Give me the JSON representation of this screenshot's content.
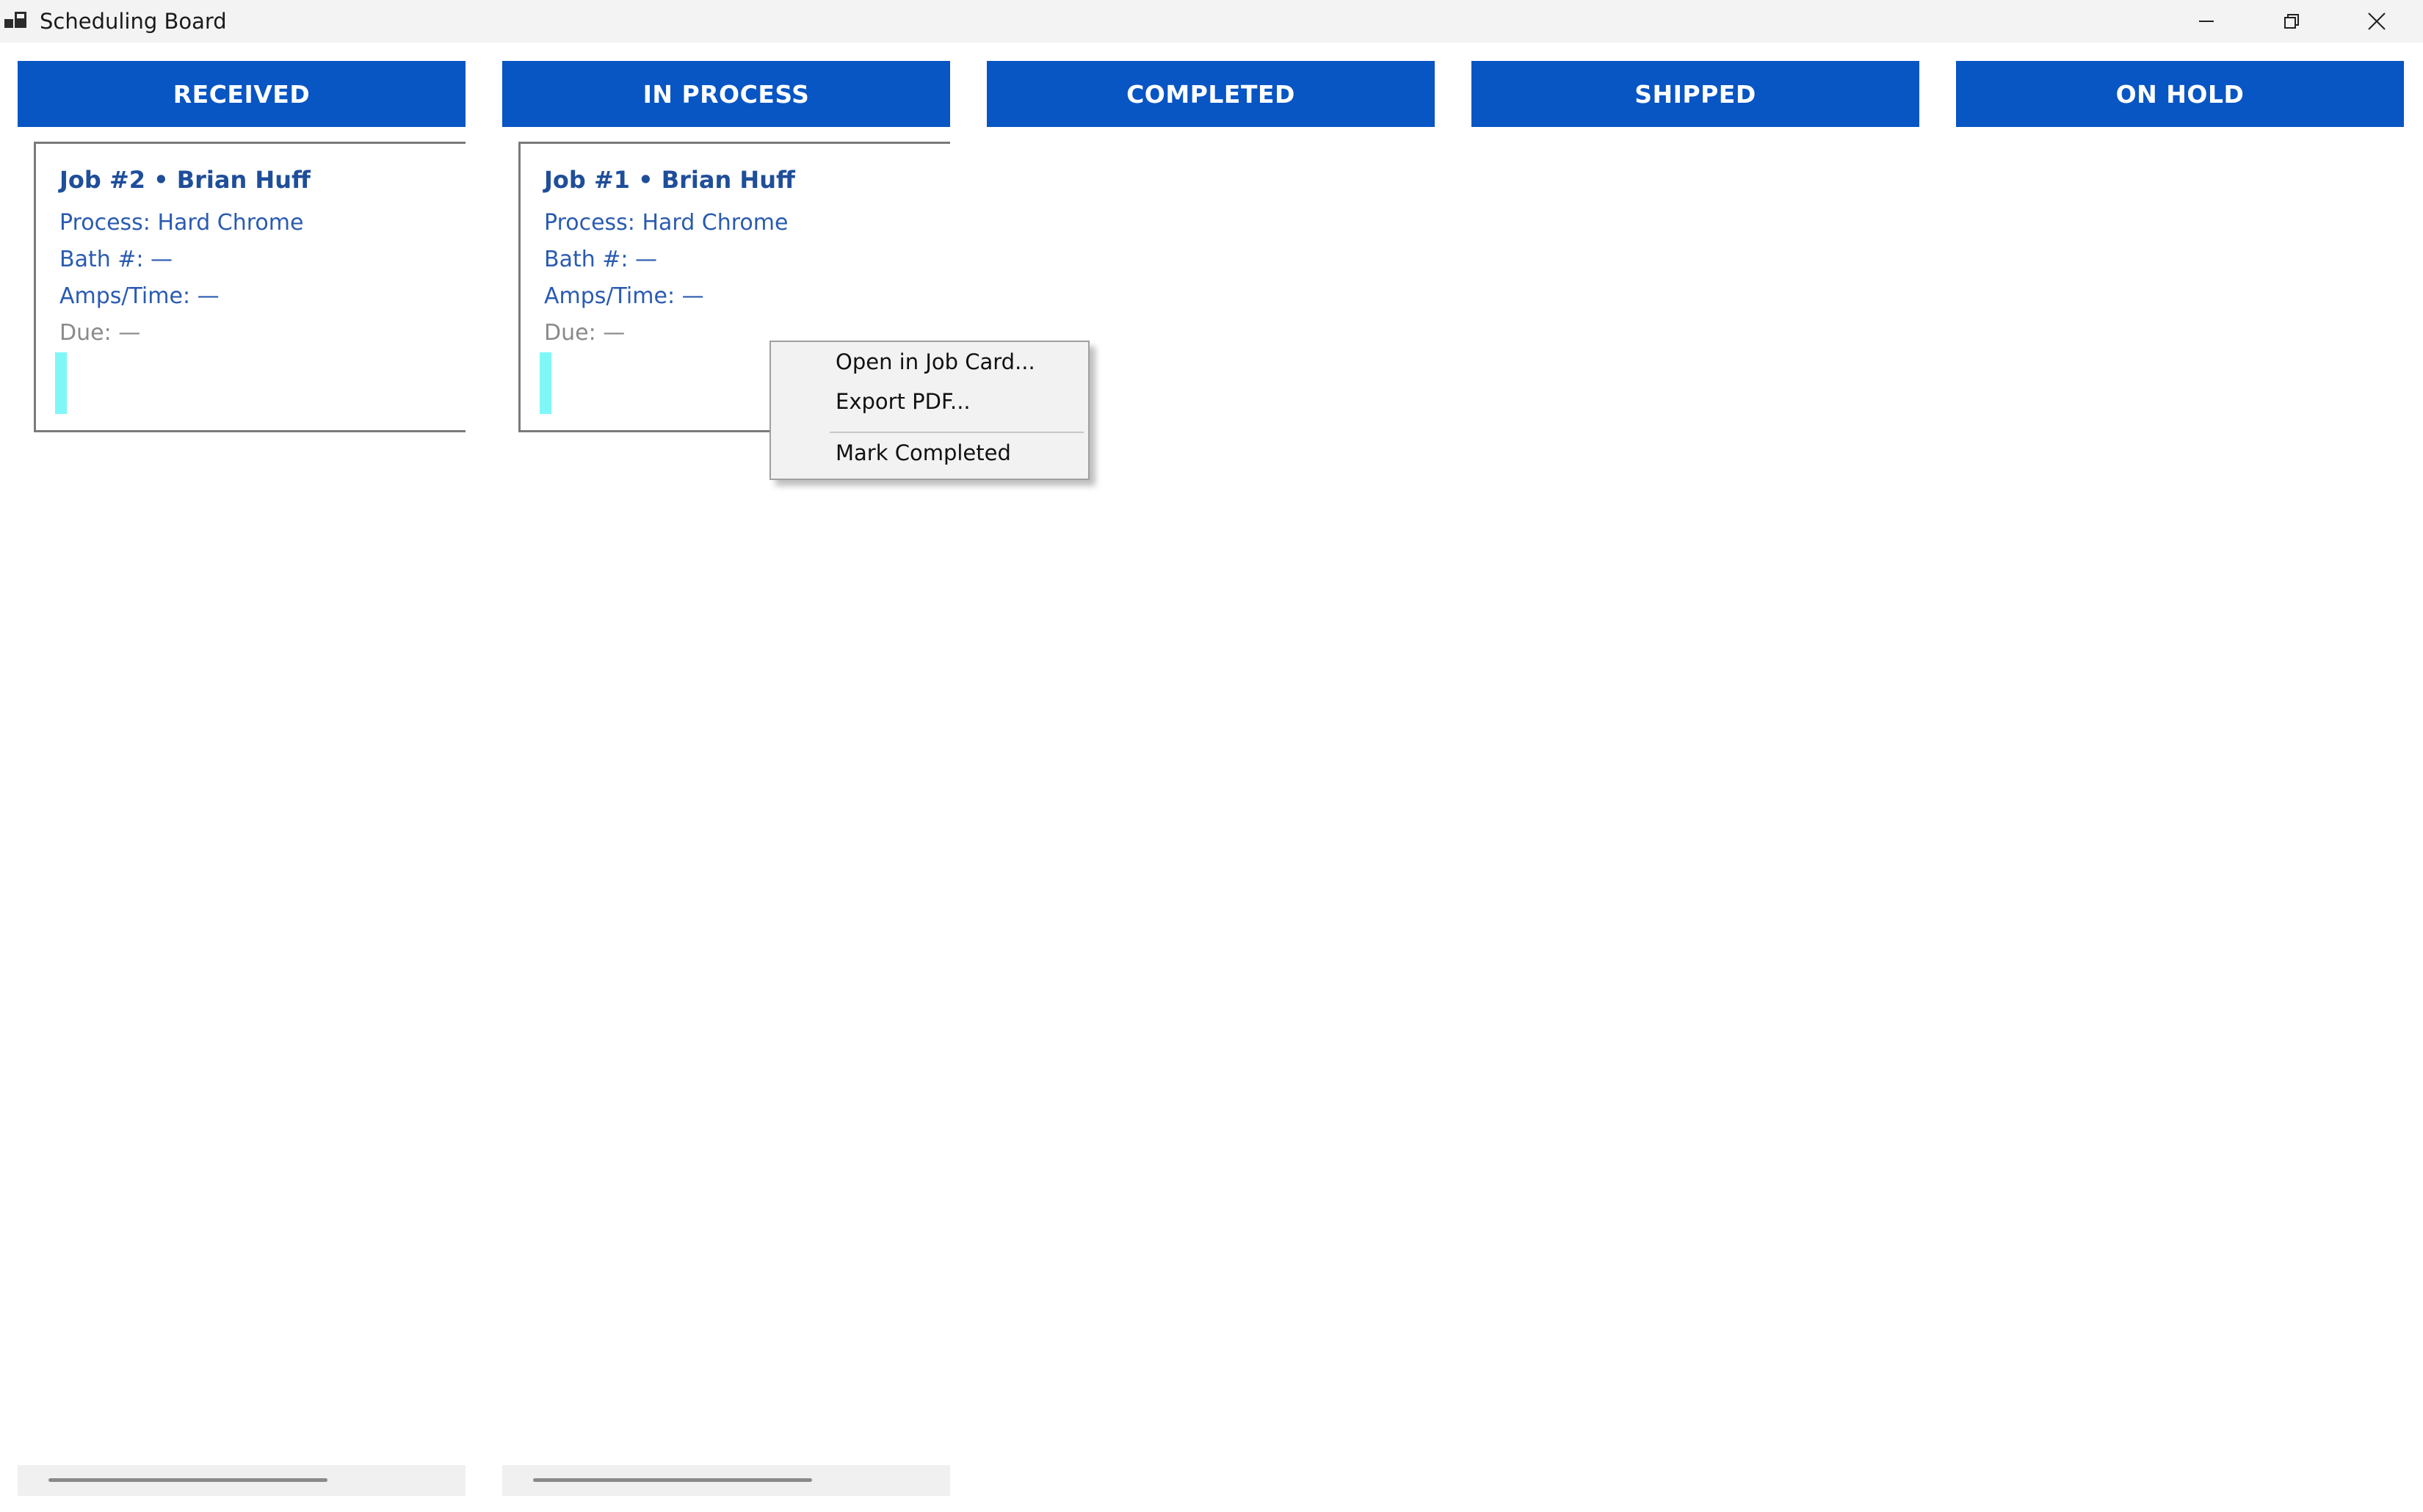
{
  "window": {
    "title": "Scheduling Board",
    "app_icon": "app-window-icon",
    "controls": [
      "minimize-icon",
      "restore-icon",
      "close-icon"
    ]
  },
  "colors": {
    "header_bg": "#0855c4",
    "card_title": "#1f4e9a",
    "card_text": "#2a5bb0",
    "accent": "#7ff7f7"
  },
  "columns": [
    {
      "label": "RECEIVED"
    },
    {
      "label": "IN PROCESS"
    },
    {
      "label": "COMPLETED"
    },
    {
      "label": "SHIPPED"
    },
    {
      "label": "ON HOLD"
    }
  ],
  "cards": [
    {
      "column": "RECEIVED",
      "title": "Job #2  •  Brian Huff",
      "process": "Process: Hard Chrome",
      "bath": "Bath #: —",
      "amps": "Amps/Time: —",
      "due": "Due: —"
    },
    {
      "column": "IN PROCESS",
      "title": "Job #1  •  Brian Huff",
      "process": "Process: Hard Chrome",
      "bath": "Bath #: —",
      "amps": "Amps/Time: —",
      "due": "Due: —"
    }
  ],
  "context_menu": {
    "items": [
      "Open in Job Card...",
      "Export PDF...",
      "Mark Completed"
    ]
  }
}
